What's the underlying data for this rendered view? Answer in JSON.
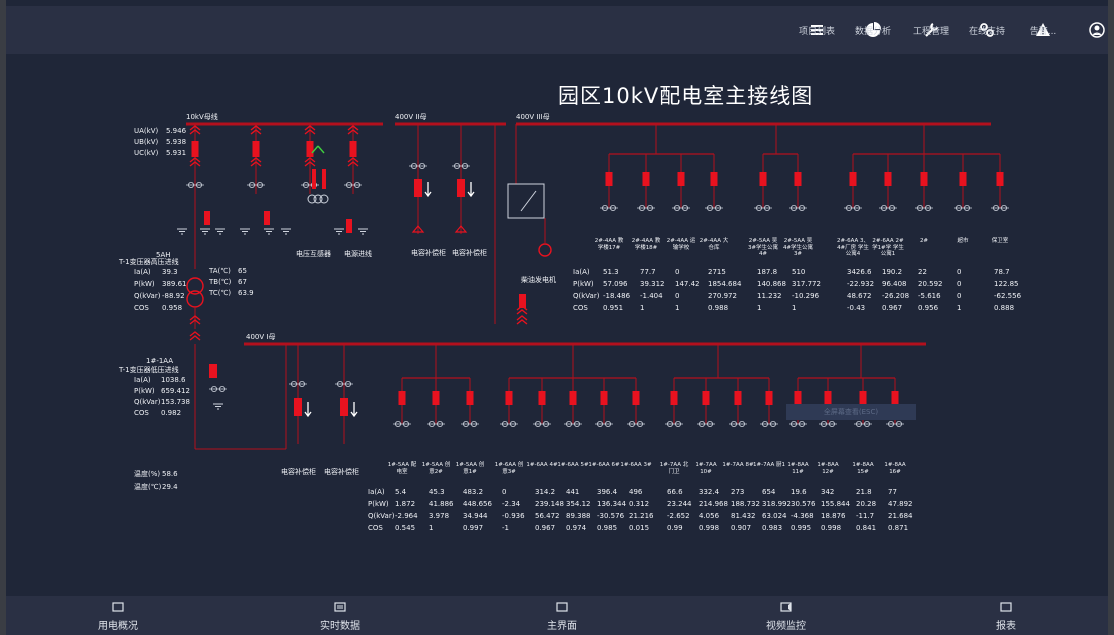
{
  "title": "园区10kV配电室主接线图",
  "top_nav": [
    {
      "label": "项目列表",
      "icon": "list-icon"
    },
    {
      "label": "数据分析",
      "icon": "pie-chart-icon"
    },
    {
      "label": "工程管理",
      "icon": "wrench-icon"
    },
    {
      "label": "在线支持",
      "icon": "link-icon"
    },
    {
      "label": "告警...",
      "icon": "warning-icon"
    },
    {
      "label": "...",
      "icon": "user-icon"
    }
  ],
  "bottom_nav": [
    {
      "label": "用电概况",
      "icon": "monitor-icon"
    },
    {
      "label": "实时数据",
      "icon": "list-icon"
    },
    {
      "label": "主界面",
      "icon": "home-icon"
    },
    {
      "label": "视频监控",
      "icon": "video-icon"
    },
    {
      "label": "报表",
      "icon": "table-icon"
    }
  ],
  "buses": {
    "bus_10kv": "10kV母线",
    "bus_400v_ii": "400V II母",
    "bus_400v_iii": "400V III母",
    "bus_400v_i": "400V I母"
  },
  "voltage": [
    {
      "label": "UA(kV)",
      "value": "5.946"
    },
    {
      "label": "UB(kV)",
      "value": "5.938"
    },
    {
      "label": "UC(kV)",
      "value": "5.931"
    }
  ],
  "transformer_1": {
    "name": "5AH",
    "desc": "T-1变压器高压进线",
    "rows": [
      {
        "k": "Ia(A)",
        "v": "39.3"
      },
      {
        "k": "P(kW)",
        "v": "389.61"
      },
      {
        "k": "Q(kVar)",
        "v": "-88.92"
      },
      {
        "k": "COS",
        "v": "0.958"
      }
    ],
    "temps": [
      {
        "k": "TA(℃)",
        "v": "65"
      },
      {
        "k": "TB(℃)",
        "v": "67"
      },
      {
        "k": "TC(℃)",
        "v": "63.9"
      }
    ]
  },
  "transformer_2": {
    "name": "1#-1AA",
    "desc": "T-1变压器低压进线",
    "rows": [
      {
        "k": "Ia(A)",
        "v": "1038.6"
      },
      {
        "k": "P(kW)",
        "v": "659.412"
      },
      {
        "k": "Q(kVar)",
        "v": "153.738"
      },
      {
        "k": "COS",
        "v": "0.982"
      }
    ]
  },
  "env": [
    {
      "k": "温度(%)",
      "v": "58.6"
    },
    {
      "k": "温度(℃)",
      "v": "29.4"
    }
  ],
  "equipment_labels": {
    "pt": "电压互感器",
    "cable": "电源进线",
    "cap1": "电容补偿柜",
    "cap2": "电容补偿柜",
    "gen": "柴油发电机",
    "cap3": "电容补偿柜",
    "cap4": "电容补偿柜"
  },
  "overlay_text": "全屏幕查看(ESC)",
  "row_labels": [
    "Ia(A)",
    "P(kW)",
    "Q(kVar)",
    "COS"
  ],
  "upper_feeders": [
    {
      "name": "2#-4AA 教学楼17#",
      "ia": "51.3",
      "p": "57.096",
      "q": "-18.486",
      "cos": "0.951"
    },
    {
      "name": "2#-4AA 教学楼18#",
      "ia": "77.7",
      "p": "39.312",
      "q": "-1.404",
      "cos": "1"
    },
    {
      "name": "2#-4AA 运输学校",
      "ia": "0",
      "p": "147.42",
      "q": "0",
      "cos": "1"
    },
    {
      "name": "2#-4AA 大仓库",
      "ia": "2715",
      "p": "1854.684",
      "q": "270.972",
      "cos": "0.988"
    },
    {
      "name": "2#-5AA 吴3#学生公寓4#",
      "ia": "187.8",
      "p": "140.868",
      "q": "11.232",
      "cos": "1"
    },
    {
      "name": "2#-5AA 吴4#学生公寓3#",
      "ia": "510",
      "p": "317.772",
      "q": "-10.296",
      "cos": "1"
    },
    {
      "name": "2#-6AA 3、4#厂房 学生公寓4",
      "ia": "3426.6",
      "p": "-22.932",
      "q": "48.672",
      "cos": "-0.43"
    },
    {
      "name": "2#-6AA 2#学1#学 学生公寓1",
      "ia": "190.2",
      "p": "96.408",
      "q": "-26.208",
      "cos": "0.967"
    },
    {
      "name": "2#",
      "ia": "22",
      "p": "20.592",
      "q": "-5.616",
      "cos": "0.956"
    },
    {
      "name": "超市",
      "ia": "0",
      "p": "0",
      "q": "0",
      "cos": "1"
    },
    {
      "name": "保卫室",
      "ia": "78.7",
      "p": "122.85",
      "q": "-62.556",
      "cos": "0.888"
    }
  ],
  "lower_feeders": [
    {
      "name": "1#-5AA 配电室",
      "ia": "5.4",
      "p": "1.872",
      "q": "-2.964",
      "cos": "0.545"
    },
    {
      "name": "1#-5AA 创意2#",
      "ia": "45.3",
      "p": "41.886",
      "q": "3.978",
      "cos": "1"
    },
    {
      "name": "1#-5AA 创意1#",
      "ia": "483.2",
      "p": "448.656",
      "q": "34.944",
      "cos": "0.997"
    },
    {
      "name": "1#-6AA 创意3#",
      "ia": "0",
      "p": "-2.34",
      "q": "-0.936",
      "cos": "-1"
    },
    {
      "name": "1#-6AA 4#",
      "ia": "314.2",
      "p": "239.148",
      "q": "56.472",
      "cos": "0.967"
    },
    {
      "name": "1#-6AA 5#",
      "ia": "441",
      "p": "354.12",
      "q": "89.388",
      "cos": "0.974"
    },
    {
      "name": "1#-6AA 6#",
      "ia": "396.4",
      "p": "136.344",
      "q": "-30.576",
      "cos": "0.985"
    },
    {
      "name": "1#-6AA 3#",
      "ia": "496",
      "p": "0.312",
      "q": "21.216",
      "cos": "0.015"
    },
    {
      "name": "1#-7AA 北门卫",
      "ia": "66.6",
      "p": "23.244",
      "q": "-2.652",
      "cos": "0.99"
    },
    {
      "name": "1#-7AA 10#",
      "ia": "332.4",
      "p": "214.968",
      "q": "4.056",
      "cos": "0.998"
    },
    {
      "name": "1#-7AA 8#",
      "ia": "273",
      "p": "188.732",
      "q": "81.432",
      "cos": "0.907"
    },
    {
      "name": "1#-7AA 厨1",
      "ia": "654",
      "p": "318.992",
      "q": "63.024",
      "cos": "0.983"
    },
    {
      "name": "1#-8AA 11#",
      "ia": "19.6",
      "p": "30.576",
      "q": "-4.368",
      "cos": "0.995"
    },
    {
      "name": "1#-8AA 12#",
      "ia": "342",
      "p": "155.844",
      "q": "18.876",
      "cos": "0.998"
    },
    {
      "name": "1#-8AA 15#",
      "ia": "21.8",
      "p": "20.28",
      "q": "-11.7",
      "cos": "0.841"
    },
    {
      "name": "1#-8AA 16#",
      "ia": "77",
      "p": "47.892",
      "q": "21.684",
      "cos": "0.871"
    }
  ],
  "colors": {
    "bus": "#b3101d",
    "breaker": "#e8121f",
    "background": "#1f2638",
    "bar": "#2a3044"
  }
}
